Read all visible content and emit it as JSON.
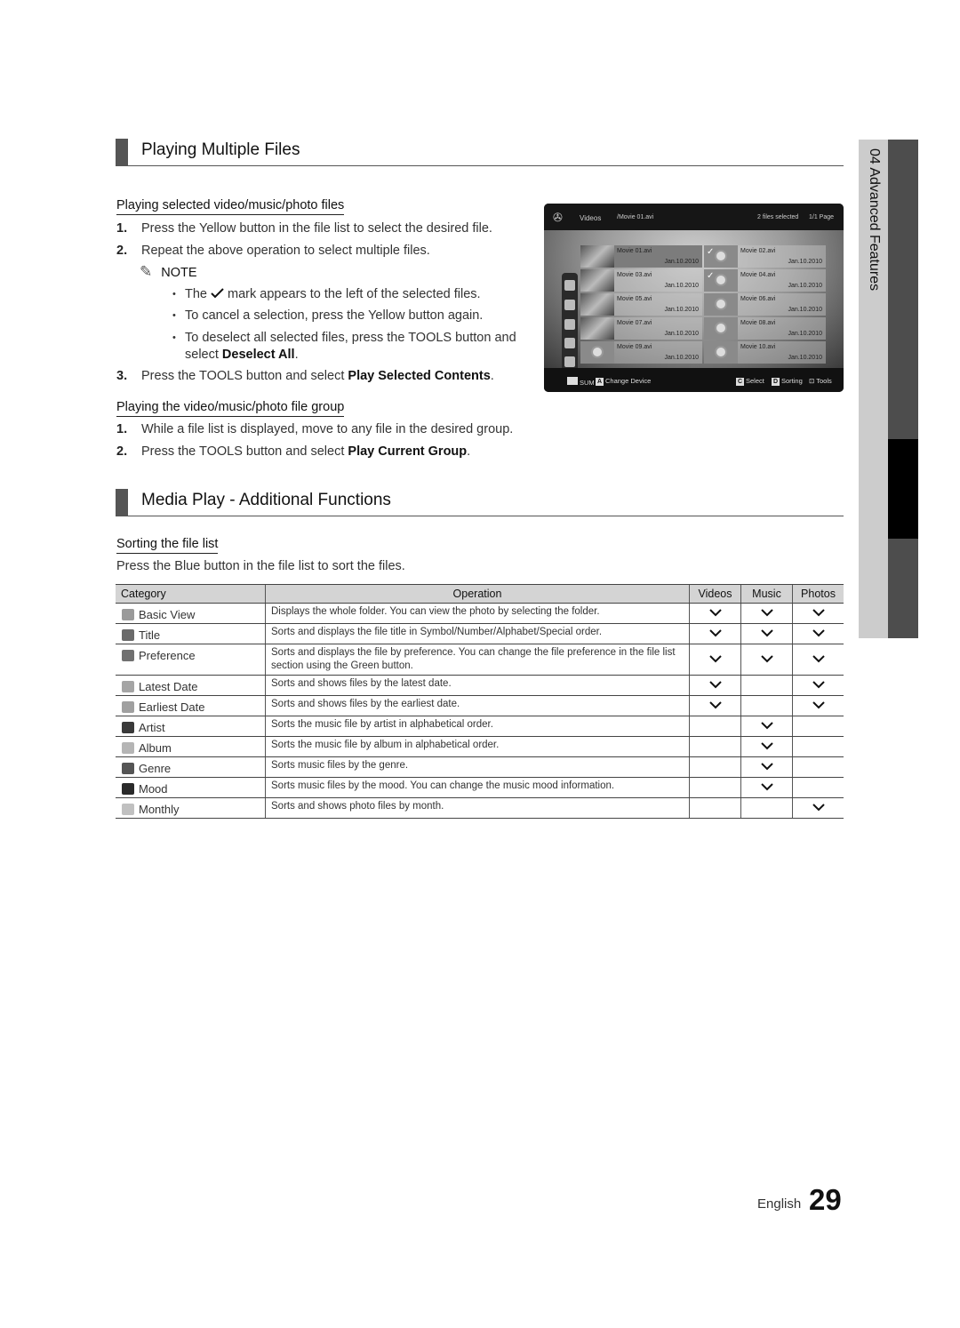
{
  "section1": {
    "title": "Playing Multiple Files",
    "sub1": {
      "heading": "Playing selected video/music/photo files",
      "steps": [
        {
          "num": "1.",
          "pre": "Press the Yellow button in the file list to select the desired file.",
          "bold": "",
          "post": ""
        },
        {
          "num": "2.",
          "pre": "Repeat the above operation to select multiple files.",
          "bold": "",
          "post": ""
        },
        {
          "num": "3.",
          "pre": "Press the TOOLS button and select ",
          "bold": "Play Selected Contents",
          "post": "."
        }
      ],
      "note_label": "NOTE",
      "note_icon": "pencil-icon",
      "bullets": [
        {
          "pre": "The ",
          "mid": " mark appears to the left of the selected files.",
          "bold": "",
          "post": ""
        },
        {
          "pre": "To cancel a selection, press the Yellow button again.",
          "mid": "",
          "bold": "",
          "post": ""
        },
        {
          "pre": "To deselect all selected files, press the TOOLS button and select ",
          "mid": "",
          "bold": "Deselect All",
          "post": "."
        }
      ]
    },
    "sub2": {
      "heading": "Playing the video/music/photo file group",
      "steps": [
        {
          "num": "1.",
          "pre": "While a file list is displayed, move to any file in the desired group.",
          "bold": "",
          "post": ""
        },
        {
          "num": "2.",
          "pre": "Press the TOOLS button and select ",
          "bold": "Play Current Group",
          "post": "."
        }
      ]
    }
  },
  "tv_screen": {
    "section": "Videos",
    "path": "/Movie 01.avi",
    "selected_count": "2 files selected",
    "page": "1/1 Page",
    "files": [
      {
        "name": "Movie 01.avi",
        "date": "Jan.10.2010",
        "thumb": "photo",
        "checked": false,
        "focused": true
      },
      {
        "name": "Movie 02.avi",
        "date": "Jan.10.2010",
        "thumb": "reel",
        "checked": true,
        "focused": false
      },
      {
        "name": "Movie 03.avi",
        "date": "Jan.10.2010",
        "thumb": "photo",
        "checked": false,
        "focused": false
      },
      {
        "name": "Movie 04.avi",
        "date": "Jan.10.2010",
        "thumb": "reel",
        "checked": true,
        "focused": false
      },
      {
        "name": "Movie 05.avi",
        "date": "Jan.10.2010",
        "thumb": "photo",
        "checked": false,
        "focused": false
      },
      {
        "name": "Movie 06.avi",
        "date": "Jan.10.2010",
        "thumb": "reel",
        "checked": false,
        "focused": false
      },
      {
        "name": "Movie 07.avi",
        "date": "Jan.10.2010",
        "thumb": "photo",
        "checked": false,
        "focused": false
      },
      {
        "name": "Movie 08.avi",
        "date": "Jan.10.2010",
        "thumb": "reel",
        "checked": false,
        "focused": false
      },
      {
        "name": "Movie 09.avi",
        "date": "Jan.10.2010",
        "thumb": "reel",
        "checked": false,
        "focused": false
      },
      {
        "name": "Movie 10.avi",
        "date": "Jan.10.2010",
        "thumb": "reel",
        "checked": false,
        "focused": false
      }
    ],
    "footer": {
      "device": "SUM",
      "a_key": "A",
      "a_label": "Change Device",
      "c_key": "C",
      "c_label": "Select",
      "d_key": "D",
      "d_label": "Sorting",
      "tools_label": "Tools"
    }
  },
  "section2": {
    "title": "Media Play - Additional Functions",
    "sub_heading": "Sorting the file list",
    "intro": "Press the Blue button in the file list to sort the files.",
    "table": {
      "headers": [
        "Category",
        "Operation",
        "Videos",
        "Music",
        "Photos"
      ],
      "rows": [
        {
          "icon": "folder-icon",
          "icon_color": "#9a9a9a",
          "category": "Basic View",
          "operation": "Displays the whole folder. You can view the photo by selecting the folder.",
          "videos": true,
          "music": true,
          "photos": true
        },
        {
          "icon": "alphabet-sort-icon",
          "icon_color": "#6a6a6a",
          "category": "Title",
          "operation": "Sorts and displays the file title in Symbol/Number/Alphabet/Special order.",
          "videos": true,
          "music": true,
          "photos": true
        },
        {
          "icon": "star-icon",
          "icon_color": "#707070",
          "category": "Preference",
          "operation": "Sorts and displays the file by preference. You can change the file preference in the file list section using the Green button.",
          "videos": true,
          "music": true,
          "photos": true
        },
        {
          "icon": "calendar-latest-icon",
          "icon_color": "#a5a5a5",
          "category": "Latest Date",
          "operation": "Sorts and shows files by the latest date.",
          "videos": true,
          "music": false,
          "photos": true
        },
        {
          "icon": "calendar-earliest-icon",
          "icon_color": "#a0a0a0",
          "category": "Earliest Date",
          "operation": "Sorts and shows files by the earliest date.",
          "videos": true,
          "music": false,
          "photos": true
        },
        {
          "icon": "artist-icon",
          "icon_color": "#3a3a3a",
          "category": "Artist",
          "operation": "Sorts the music file by artist in alphabetical order.",
          "videos": false,
          "music": true,
          "photos": false
        },
        {
          "icon": "album-icon",
          "icon_color": "#b5b5b5",
          "category": "Album",
          "operation": "Sorts the music file by album in alphabetical order.",
          "videos": false,
          "music": true,
          "photos": false
        },
        {
          "icon": "genre-guitar-icon",
          "icon_color": "#555555",
          "category": "Genre",
          "operation": "Sorts music files by the genre.",
          "videos": false,
          "music": true,
          "photos": false
        },
        {
          "icon": "mood-icon",
          "icon_color": "#2a2a2a",
          "category": "Mood",
          "operation": "Sorts music files by the mood. You can change the music mood information.",
          "videos": false,
          "music": true,
          "photos": false
        },
        {
          "icon": "monthly-calendar-icon",
          "icon_color": "#c0c0c0",
          "category": "Monthly",
          "operation": "Sorts and shows photo files by month.",
          "videos": false,
          "music": false,
          "photos": true
        }
      ]
    }
  },
  "side_tab": {
    "label": "04  Advanced Features"
  },
  "footer": {
    "language": "English",
    "page_number": "29"
  }
}
